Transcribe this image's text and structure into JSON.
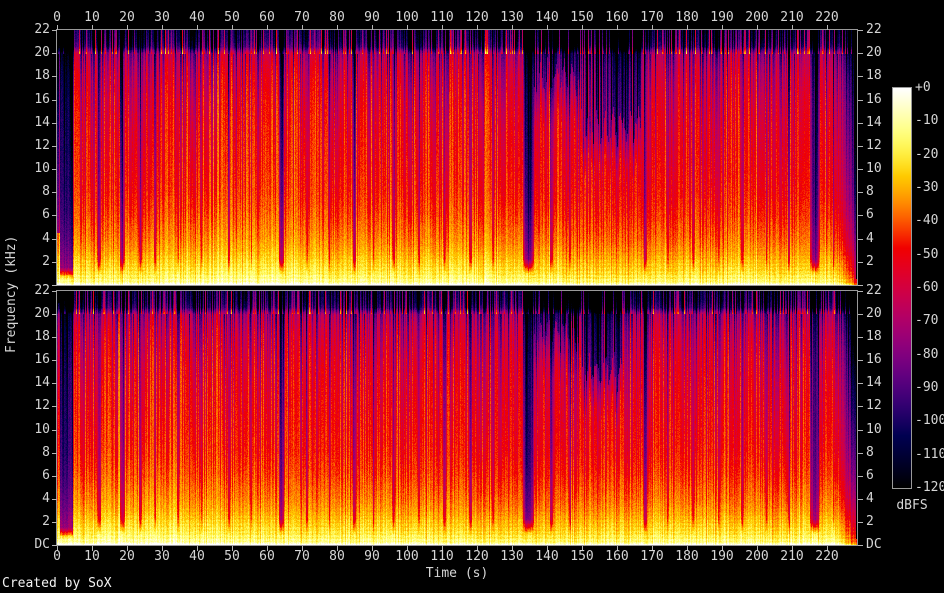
{
  "credit": "Created by SoX",
  "chart_data": {
    "type": "heatmap",
    "subtype": "stereo-audio-spectrogram",
    "title": "",
    "x_axis": {
      "label": "Time (s)",
      "ticks": [
        0,
        10,
        20,
        30,
        40,
        50,
        60,
        70,
        80,
        90,
        100,
        110,
        120,
        130,
        140,
        150,
        160,
        170,
        180,
        190,
        200,
        210,
        220
      ],
      "range_s": [
        0,
        228.6
      ]
    },
    "y_axis": {
      "label": "Frequency (kHz)",
      "ticks": [
        "22",
        "20",
        "18",
        "16",
        "14",
        "12",
        "10",
        "8",
        "6",
        "4",
        "2"
      ],
      "dc_label": "DC",
      "range_khz": [
        0,
        22
      ]
    },
    "colorbar": {
      "label": "dBFS",
      "ticks": [
        "+0",
        "-10",
        "-20",
        "-30",
        "-40",
        "-50",
        "-60",
        "-70",
        "-80",
        "-90",
        "-100",
        "-110",
        "-120"
      ],
      "range_db": [
        0,
        -120
      ],
      "palette_stops": [
        [
          "0",
          "#ffffff"
        ],
        [
          "-12",
          "#fffa8b"
        ],
        [
          "-24",
          "#ffd917"
        ],
        [
          "-36",
          "#fe7c00"
        ],
        [
          "-48",
          "#f00000"
        ],
        [
          "-60",
          "#d20040"
        ],
        [
          "-72",
          "#a6006e"
        ],
        [
          "-84",
          "#6e0080"
        ],
        [
          "-96",
          "#2e006e"
        ],
        [
          "-108",
          "#000041"
        ],
        [
          "-120",
          "#000000"
        ]
      ]
    },
    "panels": [
      {
        "label": "top"
      },
      {
        "label": "bottom"
      }
    ],
    "audio_features": {
      "duration_s": 228.6,
      "lowpass_edge_khz": 20.2,
      "spectral_envelope_khz_db": [
        [
          0,
          -4
        ],
        [
          0.15,
          -7
        ],
        [
          0.4,
          -12
        ],
        [
          1,
          -18
        ],
        [
          2,
          -24
        ],
        [
          3,
          -30
        ],
        [
          4,
          -34
        ],
        [
          6,
          -40
        ],
        [
          8,
          -44
        ],
        [
          10,
          -46
        ],
        [
          12,
          -48
        ],
        [
          14,
          -50
        ],
        [
          16,
          -53
        ],
        [
          18,
          -58
        ],
        [
          19,
          -62
        ],
        [
          20,
          -68
        ],
        [
          20.25,
          -80
        ],
        [
          20.6,
          -97
        ],
        [
          21.2,
          -104
        ],
        [
          22,
          -108
        ]
      ],
      "intro_transient_end_s": 0.8,
      "intro_quiet": {
        "t0": 0.8,
        "t1": 4.3,
        "atten_db": 52
      },
      "gaps_s_w_db": [
        [
          11.3,
          1.2,
          34
        ],
        [
          17.8,
          1.5,
          38
        ],
        [
          23.3,
          0.9,
          30
        ],
        [
          27.6,
          0.7,
          24
        ],
        [
          34.2,
          0.6,
          20
        ],
        [
          41.0,
          0.5,
          18
        ],
        [
          48.6,
          0.8,
          24
        ],
        [
          55.2,
          0.5,
          16
        ],
        [
          63.2,
          1.6,
          42
        ],
        [
          71.0,
          0.6,
          20
        ],
        [
          77.4,
          0.5,
          16
        ],
        [
          84.3,
          1.0,
          30
        ],
        [
          90.1,
          0.5,
          16
        ],
        [
          95.6,
          0.9,
          26
        ],
        [
          103.0,
          0.6,
          18
        ],
        [
          110.2,
          0.8,
          22
        ],
        [
          117.6,
          1.0,
          26
        ],
        [
          124.2,
          0.6,
          18
        ],
        [
          132.9,
          3.4,
          52
        ],
        [
          140.6,
          1.1,
          30
        ],
        [
          146.2,
          0.6,
          18
        ],
        [
          167.4,
          1.1,
          32
        ],
        [
          174.2,
          0.5,
          16
        ],
        [
          181.3,
          0.8,
          22
        ],
        [
          188.6,
          0.6,
          18
        ],
        [
          195.2,
          0.9,
          24
        ],
        [
          202.3,
          0.6,
          18
        ],
        [
          208.6,
          0.8,
          22
        ],
        [
          215.0,
          2.8,
          48
        ],
        [
          221.6,
          0.5,
          16
        ]
      ],
      "channels": [
        {
          "label": "top",
          "intro_transient_top_khz": 4.5,
          "quiet_high_regions": [
            {
              "t0": 136.3,
              "t1": 149.6,
              "above_khz": 18.0,
              "atten_db": 34
            },
            {
              "t0": 149.6,
              "t1": 166.8,
              "above_khz": 13.8,
              "atten_db": 42
            }
          ]
        },
        {
          "label": "bottom",
          "intro_transient_top_khz": 21,
          "quiet_high_regions": [
            {
              "t0": 136.3,
              "t1": 149.6,
              "above_khz": 18.4,
              "atten_db": 30
            },
            {
              "t0": 149.6,
              "t1": 161.5,
              "above_khz": 15.2,
              "atten_db": 42
            }
          ]
        }
      ],
      "fade_out": {
        "t0": 222.5,
        "black_after": 228.2
      }
    }
  }
}
